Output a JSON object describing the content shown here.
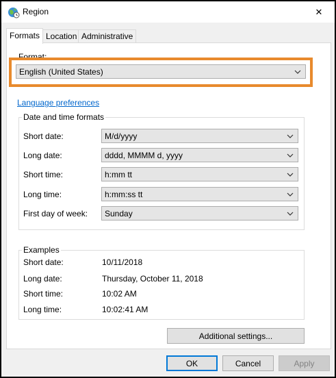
{
  "window": {
    "title": "Region",
    "close_glyph": "✕"
  },
  "tabs": [
    {
      "label": "Formats"
    },
    {
      "label": "Location"
    },
    {
      "label": "Administrative"
    }
  ],
  "format": {
    "label": "Format:",
    "value": "English (United States)"
  },
  "language_link": "Language preferences",
  "datetime": {
    "title": "Date and time formats",
    "rows": [
      {
        "label": "Short date:",
        "value": "M/d/yyyy"
      },
      {
        "label": "Long date:",
        "value": "dddd, MMMM d, yyyy"
      },
      {
        "label": "Short time:",
        "value": "h:mm tt"
      },
      {
        "label": "Long time:",
        "value": "h:mm:ss tt"
      },
      {
        "label": "First day of week:",
        "value": "Sunday"
      }
    ]
  },
  "examples": {
    "title": "Examples",
    "rows": [
      {
        "label": "Short date:",
        "value": "10/11/2018"
      },
      {
        "label": "Long date:",
        "value": "Thursday, October 11, 2018"
      },
      {
        "label": "Short time:",
        "value": "10:02 AM"
      },
      {
        "label": "Long time:",
        "value": "10:02:41 AM"
      }
    ]
  },
  "buttons": {
    "additional": "Additional settings...",
    "ok": "OK",
    "cancel": "Cancel",
    "apply": "Apply"
  },
  "colors": {
    "highlight": "#e88a2d",
    "link": "#0066cc",
    "focus": "#0078d7"
  },
  "icons": {
    "title": "globe-clock-icon",
    "dropdown": "chevron-down-icon",
    "close": "close-icon"
  }
}
